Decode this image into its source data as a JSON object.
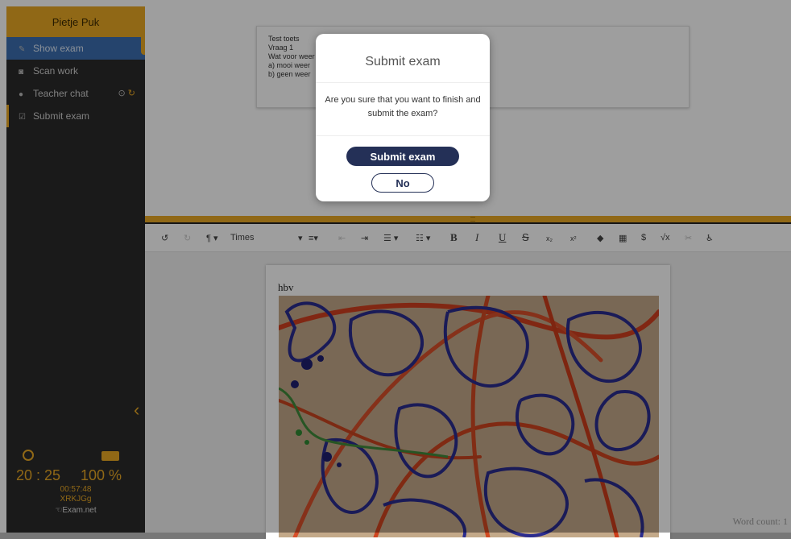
{
  "sidebar": {
    "student_name": "Pietje Puk",
    "items": [
      {
        "label": "Show exam",
        "icon": "edit-icon"
      },
      {
        "label": "Scan work",
        "icon": "camera-icon"
      },
      {
        "label": "Teacher chat",
        "icon": "chat-icon"
      },
      {
        "label": "Submit exam",
        "icon": "check-square-icon"
      }
    ],
    "status": {
      "time": "20 : 25",
      "battery": "100 %",
      "elapsed": "00:57:48",
      "exam_key": "XRKJGg",
      "brand": "Exam.net"
    }
  },
  "exam": {
    "lines": [
      "Test toets",
      "Vraag 1",
      "Wat voor weer",
      "a) mooi weer",
      "b) geen weer"
    ]
  },
  "toolbar": {
    "font_name": "Times"
  },
  "editor": {
    "text": "hbv",
    "word_count": "Word count: 1"
  },
  "modal": {
    "title": "Submit exam",
    "message": "Are you sure that you want to finish and submit the exam?",
    "confirm_label": "Submit exam",
    "cancel_label": "No"
  },
  "colors": {
    "accent": "#e9a825",
    "sidebar": "#2b2b2b",
    "active": "#3c6fb0",
    "primary_button": "#243057"
  }
}
